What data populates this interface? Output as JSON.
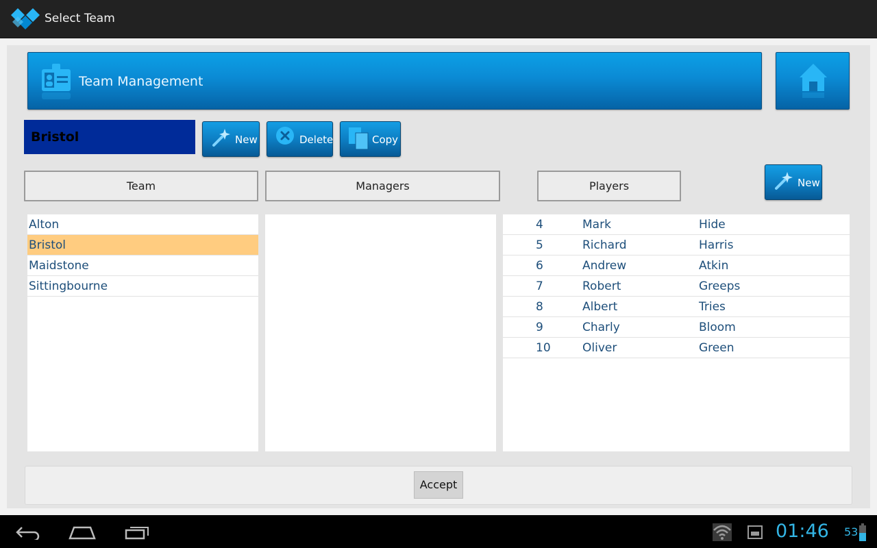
{
  "app": {
    "title": "Select Team"
  },
  "banner": {
    "title": "Team Management"
  },
  "selected_team": "Bristol",
  "team_actions": {
    "new_label": "New",
    "delete_label": "Delete",
    "copy_label": "Copy"
  },
  "tabs": {
    "team": "Team",
    "managers": "Managers",
    "players": "Players"
  },
  "players_new_label": "New",
  "teams": [
    "Alton",
    "Bristol",
    "Maidstone",
    "Sittingbourne"
  ],
  "players": [
    {
      "number": "4",
      "first": "Mark",
      "last": "Hide"
    },
    {
      "number": "5",
      "first": "Richard",
      "last": "Harris"
    },
    {
      "number": "6",
      "first": "Andrew",
      "last": "Atkin"
    },
    {
      "number": "7",
      "first": "Robert",
      "last": "Greeps"
    },
    {
      "number": "8",
      "first": "Albert",
      "last": "Tries"
    },
    {
      "number": "9",
      "first": "Charly",
      "last": "Bloom"
    },
    {
      "number": "10",
      "first": "Oliver",
      "last": "Green"
    }
  ],
  "accept_label": "Accept",
  "status": {
    "clock": "01:46",
    "battery": "53"
  },
  "colors": {
    "accent": "#0b8ad4",
    "selection": "#ffcc80",
    "team_box": "#002b99",
    "clock": "#33b5e5"
  }
}
